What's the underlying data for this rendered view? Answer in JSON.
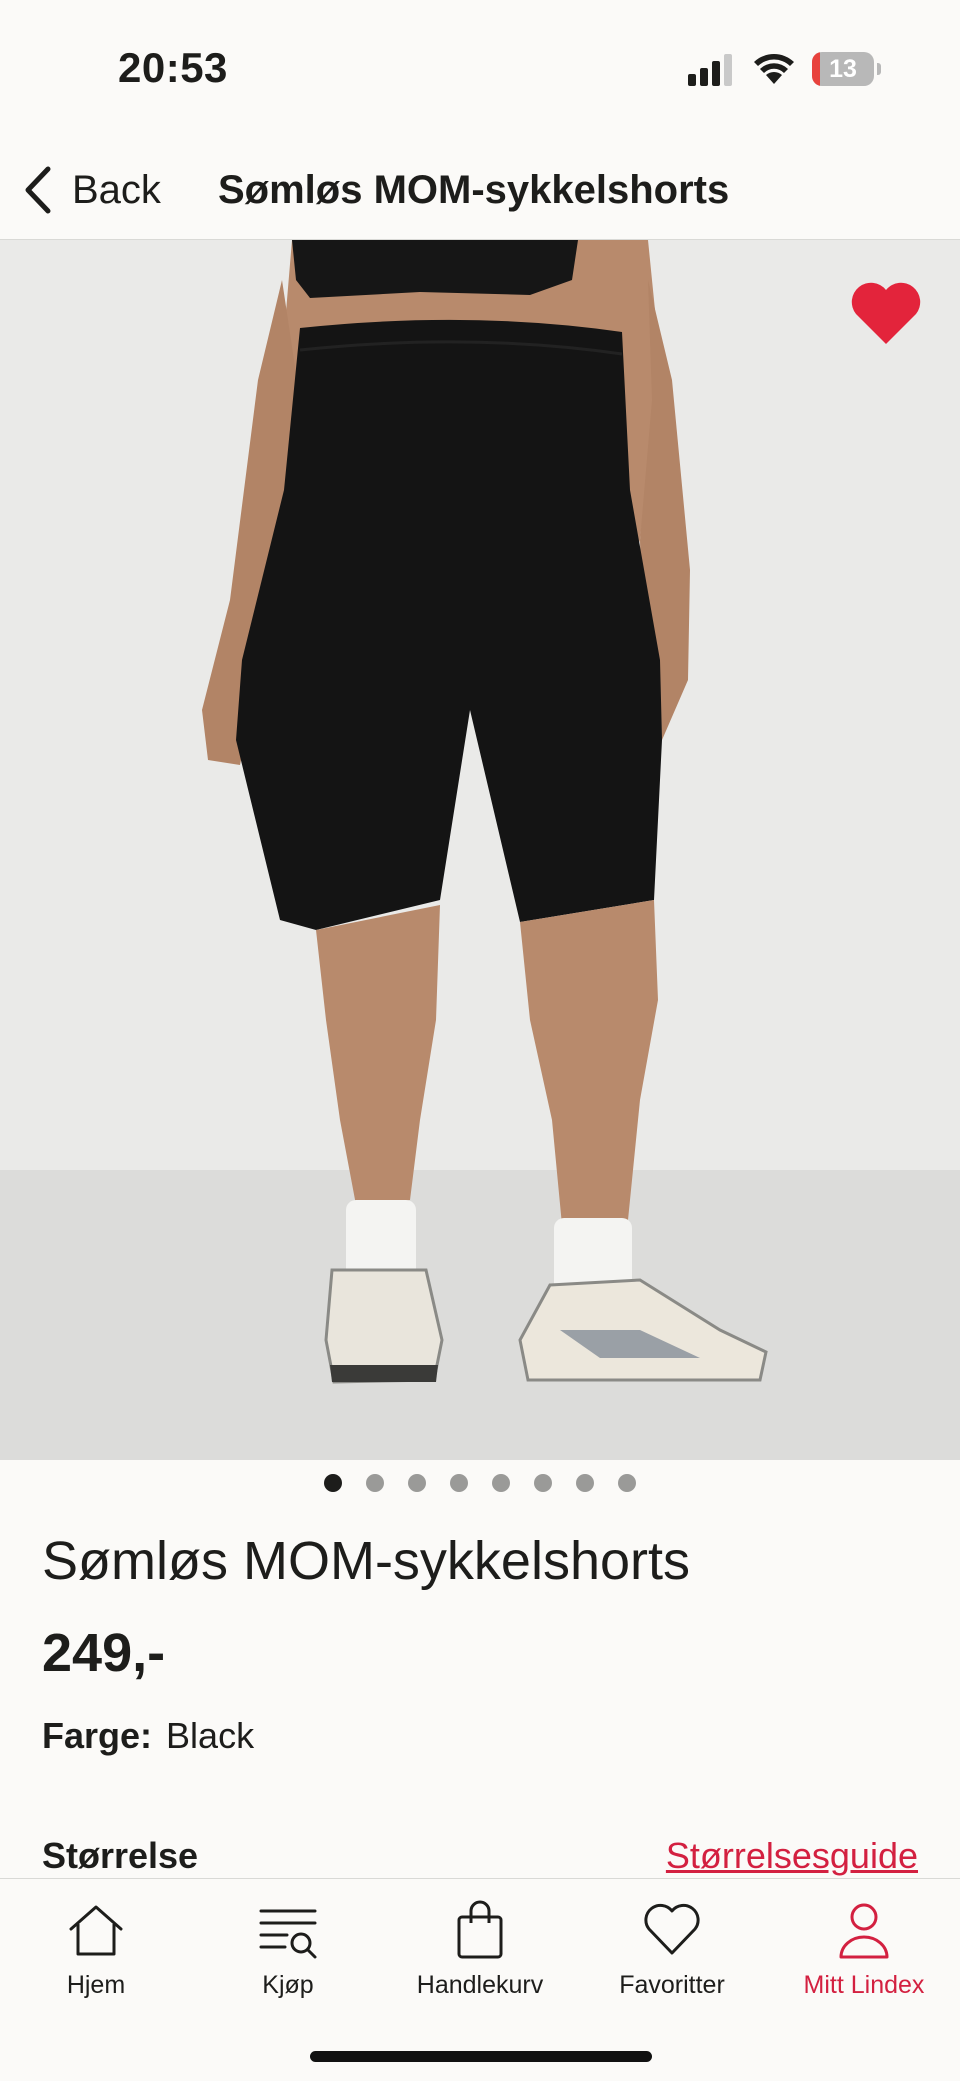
{
  "status_bar": {
    "time": "20:53",
    "battery_percent": 13,
    "battery_text": "13",
    "icons": [
      "cellular-signal-icon",
      "wifi-icon",
      "battery-icon"
    ]
  },
  "header": {
    "back_label": "Back",
    "title": "Sømløs MOM-sykkelshorts",
    "back_icon": "chevron-left-icon"
  },
  "product": {
    "is_favorite": true,
    "favorite_icon": "heart-filled-icon",
    "favorite_color": "#e3243b",
    "carousel": {
      "total_images": 8,
      "active_index": 0
    },
    "name": "Sømløs MOM-sykkelshorts",
    "price": "249,-",
    "color_label": "Farge:",
    "color_value": "Black",
    "size_label": "Størrelse",
    "size_guide_link": "Størrelsesguide"
  },
  "tab_bar": {
    "active_tab": "mitt-lindex",
    "accent_color": "#d32040",
    "tabs": [
      {
        "id": "hjem",
        "label": "Hjem",
        "icon": "home-icon"
      },
      {
        "id": "kjop",
        "label": "Kjøp",
        "icon": "search-list-icon"
      },
      {
        "id": "handlekurv",
        "label": "Handlekurv",
        "icon": "shopping-bag-icon"
      },
      {
        "id": "favoritter",
        "label": "Favoritter",
        "icon": "heart-outline-icon"
      },
      {
        "id": "mitt-lindex",
        "label": "Mitt Lindex",
        "icon": "user-icon"
      }
    ]
  }
}
